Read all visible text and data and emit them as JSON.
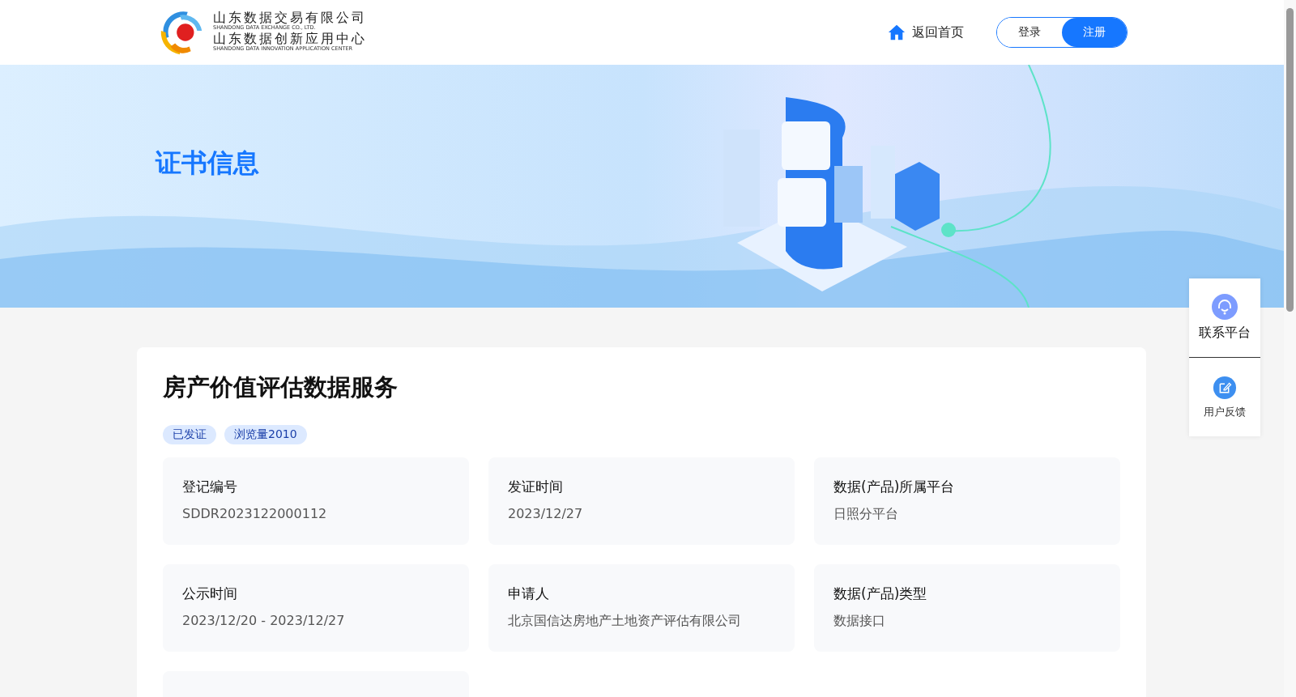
{
  "header": {
    "logo": {
      "line_1": "山东数据交易有限公司",
      "line_2": "SHANDONG DATA EXCHANGE CO., LTD.",
      "line_3": "山东数据创新应用中心",
      "line_4": "SHANDONG DATA INNOVATION APPLICATION CENTER"
    },
    "home_link": "返回首页",
    "auth_buttons": [
      {
        "label": "登录",
        "selected": false
      },
      {
        "label": "注册",
        "selected": true
      }
    ]
  },
  "banner": {
    "title": "证书信息"
  },
  "certificate": {
    "title": "房产价值评估数据服务",
    "tags": [
      "已发证",
      "浏览量2010"
    ],
    "fields": [
      {
        "label": "登记编号",
        "value": "SDDR2023122000112"
      },
      {
        "label": "发证时间",
        "value": "2023/12/27"
      },
      {
        "label": "数据(产品)所属平台",
        "value": "日照分平台"
      },
      {
        "label": "公示时间",
        "value": "2023/12/20 - 2023/12/27"
      },
      {
        "label": "申请人",
        "value": "北京国信达房地产土地资产评估有限公司"
      },
      {
        "label": "数据(产品)类型",
        "value": "数据接口"
      }
    ]
  },
  "side_widget": [
    {
      "kind": "contact",
      "label": "联系平台"
    },
    {
      "kind": "feedback",
      "label": "用户反馈"
    }
  ]
}
